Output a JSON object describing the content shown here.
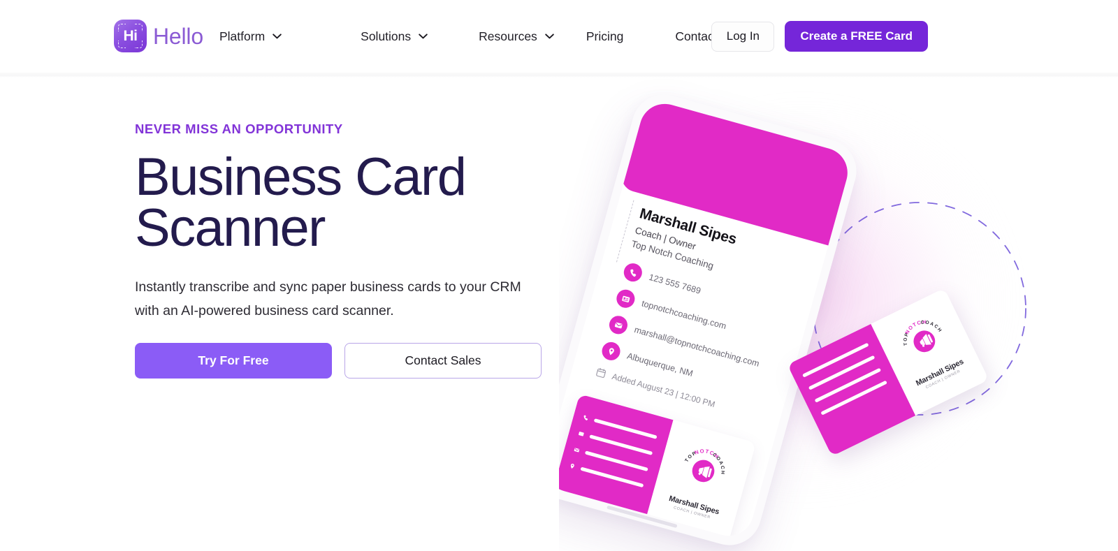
{
  "brand": {
    "mark_text": "Hi",
    "word": "Hello",
    "mark_icon": "scan-frame-icon",
    "accent": "#8b5bd4"
  },
  "header": {
    "nav": [
      {
        "label": "Platform",
        "has_dropdown": true,
        "icon": "chevron-down-icon"
      },
      {
        "label": "Solutions",
        "has_dropdown": true,
        "icon": "chevron-down-icon"
      },
      {
        "label": "Resources",
        "has_dropdown": true,
        "icon": "chevron-down-icon"
      },
      {
        "label": "Pricing",
        "has_dropdown": false
      },
      {
        "label": "Contact Sales",
        "has_dropdown": false
      }
    ],
    "login_label": "Log In",
    "cta_label": "Create a FREE Card",
    "cta_color": "#7526d9"
  },
  "hero": {
    "eyebrow": "NEVER MISS AN OPPORTUNITY",
    "headline": "Business Card Scanner",
    "subcopy": "Instantly transcribe and sync paper business cards to your CRM with an AI-powered business card scanner.",
    "primary_cta": "Try For Free",
    "secondary_cta": "Contact Sales",
    "primary_color": "#8b5cf6",
    "headline_color": "#231b4d",
    "eyebrow_color": "#8234d8"
  },
  "art": {
    "accent_magenta": "#e12ac6",
    "dashed_arc_color": "#6b4fd8",
    "contact_card": {
      "name": "Marshall Sipes",
      "role": "Coach | Owner",
      "company": "Top Notch Coaching",
      "phone": "123 555 7689",
      "website": "topnotchcoaching.com",
      "email": "marshall@topnotchcoaching.com",
      "location": "Albuquerque, NM",
      "added": "Added August 23 | 12:00 PM",
      "icons": {
        "phone": "phone-icon",
        "website": "web-card-icon",
        "email": "envelope-icon",
        "location": "map-pin-icon",
        "added": "calendar-icon"
      }
    },
    "mini_card": {
      "logo_top": "TOP",
      "logo_mid": "NOTCH",
      "logo_bottom": "COACHING",
      "logo_icon": "megaphone-icon",
      "name": "Marshall Sipes",
      "role": "Coach | Owner"
    }
  }
}
